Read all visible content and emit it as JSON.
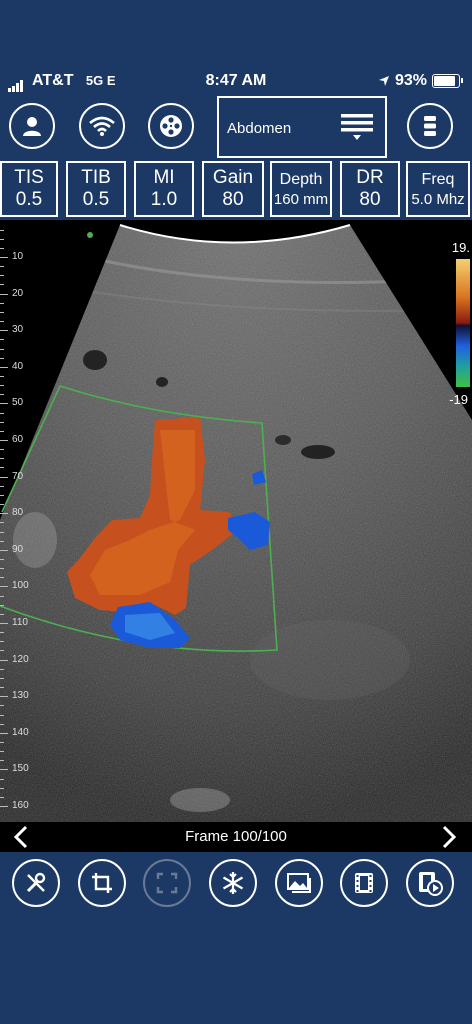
{
  "status_bar": {
    "carrier": "AT&T",
    "network": "5G E",
    "time": "8:47 AM",
    "battery": "93%"
  },
  "toolbar": {
    "preset_label": "Abdomen",
    "icons": [
      "user-icon",
      "wifi-icon",
      "film-reel-icon",
      "menu-icon"
    ]
  },
  "params": [
    {
      "name": "TIS",
      "value": "0.5"
    },
    {
      "name": "TIB",
      "value": "0.5"
    },
    {
      "name": "MI",
      "value": "1.0"
    },
    {
      "name": "Gain",
      "value": "80"
    },
    {
      "name": "Depth",
      "value": "160 mm"
    },
    {
      "name": "DR",
      "value": "80"
    },
    {
      "name": "Freq",
      "value": "5.0 Mhz"
    }
  ],
  "scale": {
    "max": "19.",
    "min": "-19"
  },
  "ruler": [
    "10",
    "20",
    "30",
    "40",
    "50",
    "60",
    "70",
    "80",
    "90",
    "100",
    "110",
    "120",
    "130",
    "140",
    "150",
    "160"
  ],
  "frame_label": "Frame 100/100",
  "colors": {
    "background": "#1c3966",
    "doppler_red": "#c8501e",
    "doppler_blue": "#1a5ad8",
    "roi_green": "#4caf50"
  },
  "bottom_icons": [
    "tools-icon",
    "crop-icon",
    "fullscreen-icon",
    "freeze-icon",
    "image-icon",
    "film-icon",
    "video-play-icon"
  ]
}
